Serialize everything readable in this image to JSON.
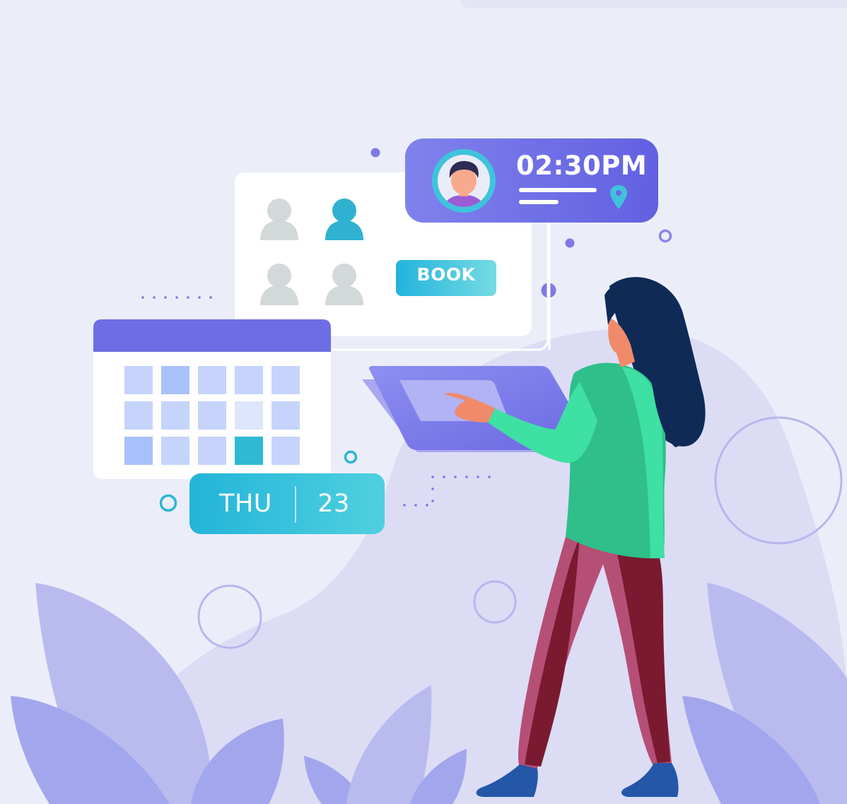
{
  "appointment_card": {
    "time": "02:30PM",
    "avatar_icon": "user-avatar",
    "location_icon": "map-pin"
  },
  "book_button": {
    "label": "BOOK"
  },
  "date_badge": {
    "day": "THU",
    "date": "23"
  },
  "colors": {
    "background": "#ebeef9",
    "primary_purple": "#6f70e6",
    "accent_teal": "#3bc6db",
    "blob": "#dcdcf5"
  }
}
